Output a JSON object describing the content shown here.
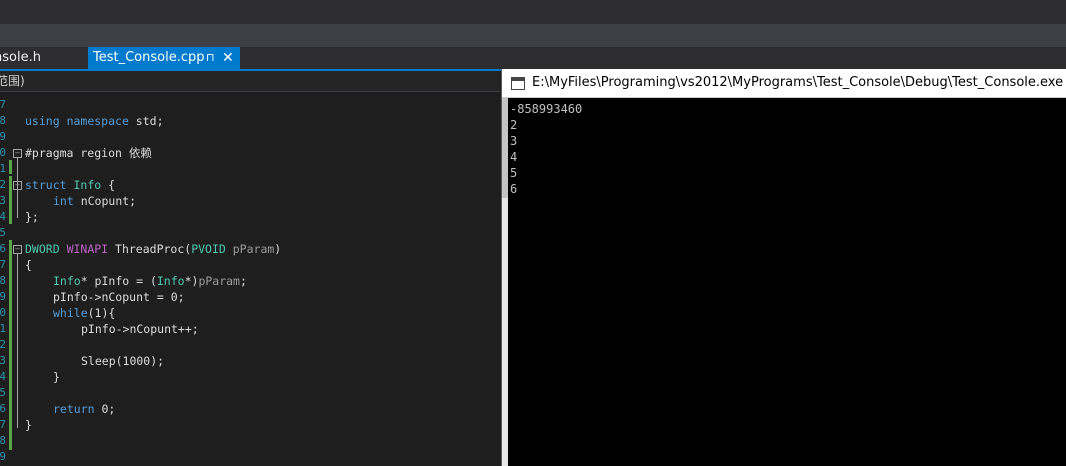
{
  "tabs": [
    {
      "label": "nsole.h",
      "active": false
    },
    {
      "label": "Test_Console.cpp",
      "active": true
    }
  ],
  "tab_pin_glyph": "⊓",
  "tab_close_glyph": "✕",
  "nav_scope": "范围)",
  "line_numbers": [
    "7",
    "8",
    "9",
    "0",
    "1",
    "2",
    "3",
    "4",
    "5",
    "6",
    "7",
    "8",
    "9",
    "0",
    "1",
    "2",
    "3",
    "4",
    "5",
    "6",
    "7",
    "8",
    "9"
  ],
  "code": {
    "l1": {
      "kw1": "using",
      "kw2": "namespace",
      "rest": " std;"
    },
    "l2": {
      "text": "#pragma region 依赖"
    },
    "l3": {
      "kw": "struct",
      "ty": "Info",
      "rest": " {"
    },
    "l4": {
      "kw": "int",
      "rest": " nCopunt;"
    },
    "l5": {
      "text": "};"
    },
    "l6": {
      "ty1": "DWORD",
      "mac": "WINAPI",
      "rest": " ThreadProc(",
      "ty2": "PVOID",
      "param": " pParam",
      ")": ")"
    },
    "l7": {
      "text": "{"
    },
    "l8": {
      "ty1": "Info",
      "mid": "* pInfo = (",
      "ty2": "Info",
      "tail": "*)",
      "param": "pParam",
      ";": ";"
    },
    "l9": {
      "text": "pInfo->nCopunt = 0;"
    },
    "l10": {
      "kw": "while",
      "rest": "(1){"
    },
    "l11": {
      "text": "pInfo->nCopunt++;"
    },
    "l12": {
      "text": "Sleep(1000);"
    },
    "l13": {
      "text": "}"
    },
    "l14": {
      "kw": "return",
      "rest": " 0;"
    },
    "l15": {
      "text": "}"
    }
  },
  "console": {
    "title": "E:\\MyFiles\\Programing\\vs2012\\MyPrograms\\Test_Console\\Debug\\Test_Console.exe",
    "lines": [
      "-858993460",
      "2",
      "3",
      "4",
      "5",
      "6"
    ]
  }
}
